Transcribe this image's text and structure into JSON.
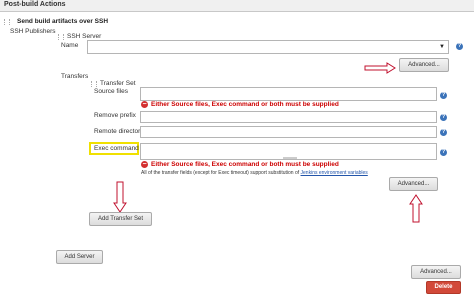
{
  "section": {
    "title": "Post-build Actions"
  },
  "plugin": {
    "title": "Send build artifacts over SSH"
  },
  "publishers": {
    "label": "SSH Publishers"
  },
  "server": {
    "label": "SSH Server",
    "name_label": "Name",
    "advanced_label": "Advanced..."
  },
  "transfers": {
    "label": "Transfers",
    "set_label": "Transfer Set",
    "source_files_label": "Source files",
    "source_error": "Either Source files, Exec command or both must be supplied",
    "remove_prefix_label": "Remove prefix",
    "remote_directory_label": "Remote directory",
    "exec_command_label": "Exec command",
    "exec_error": "Either Source files, Exec command or both must be supplied",
    "note_text": "All of the transfer fields (except for Exec timeout) support substitution of",
    "note_link": "Jenkins environment variables",
    "advanced_label": "Advanced...",
    "add_transfer_label": "Add Transfer Set"
  },
  "buttons": {
    "add_server": "Add Server",
    "advanced": "Advanced...",
    "delete": "Delete"
  },
  "icons": {
    "help": "?",
    "error": "−",
    "dropdown": "▼"
  },
  "colors": {
    "error": "#cc0000",
    "highlight": "#f0e000",
    "arrow": "#c0102e",
    "delete": "#d24939"
  }
}
